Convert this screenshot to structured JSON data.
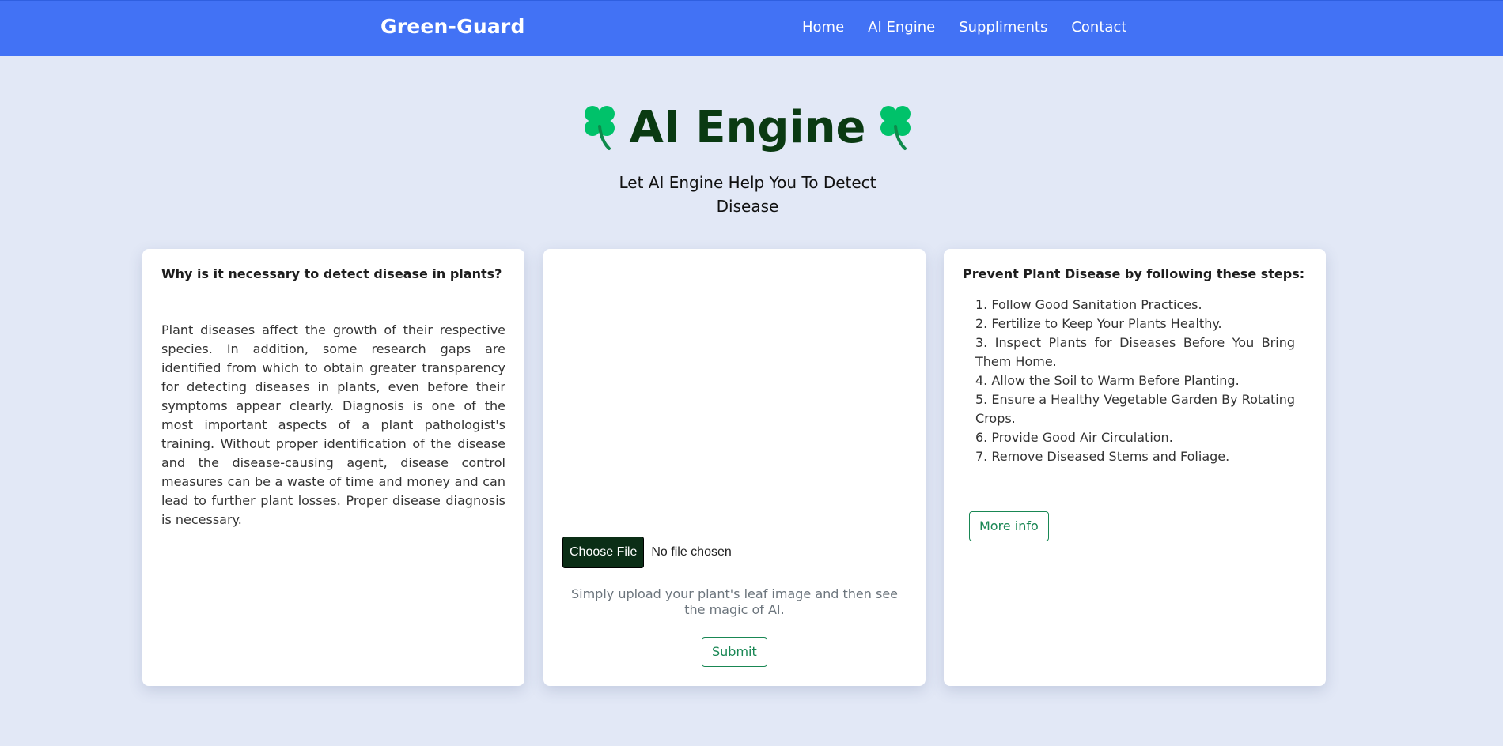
{
  "navbar": {
    "brand": "Green-Guard",
    "links": [
      "Home",
      "AI Engine",
      "Suppliments",
      "Contact"
    ]
  },
  "hero": {
    "title": "AI Engine",
    "subtitle": "Let AI Engine Help You To Detect Disease",
    "icon": "four-leaf-clover-icon"
  },
  "left_card": {
    "heading": "Why is it necessary to detect disease in plants?",
    "body": "Plant diseases affect the growth of their respective species. In addition, some research gaps are identified from which to obtain greater transparency for detecting diseases in plants, even before their symptoms appear clearly. Diagnosis is one of the most important aspects of a plant pathologist's training. Without proper identification of the disease and the disease-causing agent, disease control measures can be a waste of time and money and can lead to further plant losses. Proper disease diagnosis is necessary."
  },
  "upload_card": {
    "choose_file_label": "Choose File",
    "file_status": "No file chosen",
    "hint": "Simply upload your plant's leaf image and then see the magic of AI.",
    "submit_label": "Submit"
  },
  "right_card": {
    "heading": "Prevent Plant Disease by following these steps:",
    "steps": [
      "1. Follow Good Sanitation Practices.",
      "2. Fertilize to Keep Your Plants Healthy.",
      "3. Inspect Plants for Diseases Before You Bring Them Home.",
      "4. Allow the Soil to Warm Before Planting.",
      "5. Ensure a Healthy Vegetable Garden By Rotating Crops.",
      "6. Provide Good Air Circulation.",
      "7. Remove Diseased Stems and Foliage."
    ],
    "more_info_label": "More info"
  },
  "colors": {
    "navbar": "#4272f5",
    "background": "#e2e8f6",
    "title": "#0a3a12",
    "clover": "#00c26a",
    "outline_button": "#198754",
    "choose_file_button": "#0b2e16"
  }
}
